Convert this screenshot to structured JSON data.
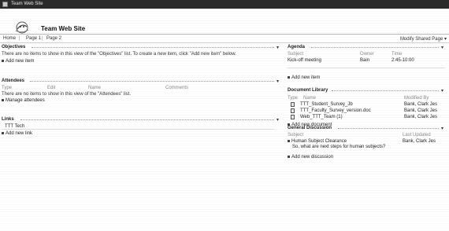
{
  "window": {
    "title": "Team Web Site"
  },
  "site": {
    "title": "Team Web Site",
    "logo_icon": "team-site-logo-icon"
  },
  "nav": {
    "items": [
      "Home",
      "Page 1",
      "Page 2"
    ],
    "modify_label": "Modify Shared Page"
  },
  "objectives": {
    "title": "Objectives",
    "empty_text": "There are no items to show in this view of the \"Objectives\" list. To create a new item, click \"Add new item\" below.",
    "add_label": "Add new item"
  },
  "attendees": {
    "title": "Attendees",
    "columns": [
      "Type",
      "Edit",
      "Name",
      "Comments"
    ],
    "empty_text": "There are no items to show in this view of the \"Attendees\" list.",
    "manage_label": "Manage attendees"
  },
  "links": {
    "title": "Links",
    "items": [
      "TTT Tech"
    ],
    "add_label": "Add new link"
  },
  "agenda": {
    "title": "Agenda",
    "columns": [
      "Subject",
      "Owner",
      "Time"
    ],
    "rows": [
      {
        "subject": "Kick-off meeting",
        "owner": "Bain",
        "time": "2:45-10:00"
      }
    ],
    "add_label": "Add new item"
  },
  "library": {
    "title": "Document Library",
    "columns": [
      "Type",
      "Name",
      "Modified By"
    ],
    "rows": [
      {
        "name": "TTT_Student_Survey_Jb",
        "modified": "Bank, Clark Jes"
      },
      {
        "name": "TTT_Faculty_Survey_version.doc",
        "modified": "Bank, Clark Jes"
      },
      {
        "name": "Web_TTT_Team (1)",
        "modified": "Bank, Clark Jes"
      }
    ],
    "add_label": "Add new document"
  },
  "discussion": {
    "title": "General Discussion",
    "columns": [
      "Subject",
      "Last Updated"
    ],
    "rows": [
      {
        "subject": "Human Subject Clearance",
        "body": "So, what are next steps for human subjects?",
        "updated": "Bank, Clark Jes"
      }
    ],
    "add_label": "Add new discussion"
  }
}
